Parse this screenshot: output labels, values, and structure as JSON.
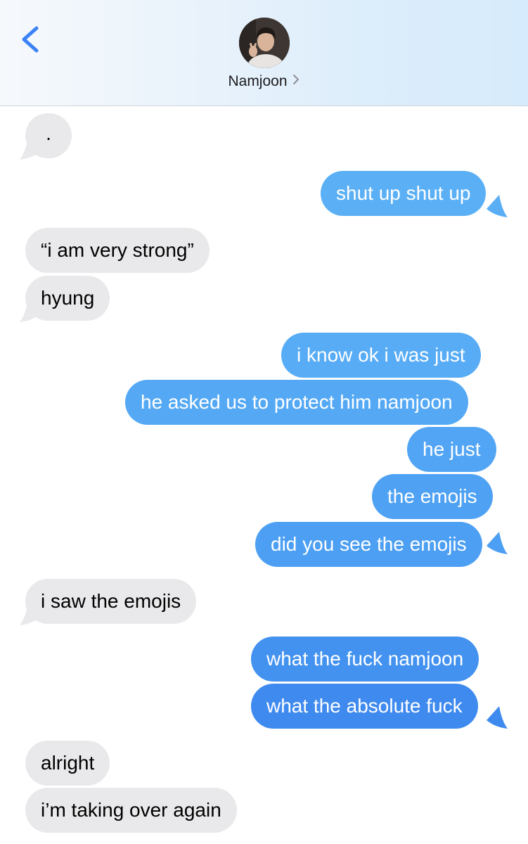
{
  "header": {
    "contact_name": "Namjoon",
    "back_icon": "chevron-left-icon",
    "detail_icon": "chevron-right-icon",
    "accent_color": "#3b82f6"
  },
  "messages": [
    {
      "from": "them",
      "text": "."
    },
    {
      "from": "me",
      "text": "shut up shut up"
    },
    {
      "from": "them",
      "text": "“i am very strong”"
    },
    {
      "from": "them",
      "text": "hyung"
    },
    {
      "from": "me",
      "text": "i know ok i was just"
    },
    {
      "from": "me",
      "text": "he asked us to protect him namjoon"
    },
    {
      "from": "me",
      "text": "he just"
    },
    {
      "from": "me",
      "text": "the emojis"
    },
    {
      "from": "me",
      "text": "did you see the emojis"
    },
    {
      "from": "them",
      "text": "i saw the emojis"
    },
    {
      "from": "me",
      "text": "what the fuck namjoon"
    },
    {
      "from": "me",
      "text": "what the absolute fuck"
    },
    {
      "from": "them",
      "text": "alright"
    },
    {
      "from": "them",
      "text": "i’m taking over again"
    }
  ],
  "colors": {
    "incoming_bubble": "#e9e9eb",
    "outgoing_bubble_top": "#5bb0f5",
    "outgoing_bubble_bottom": "#3d86ef"
  }
}
